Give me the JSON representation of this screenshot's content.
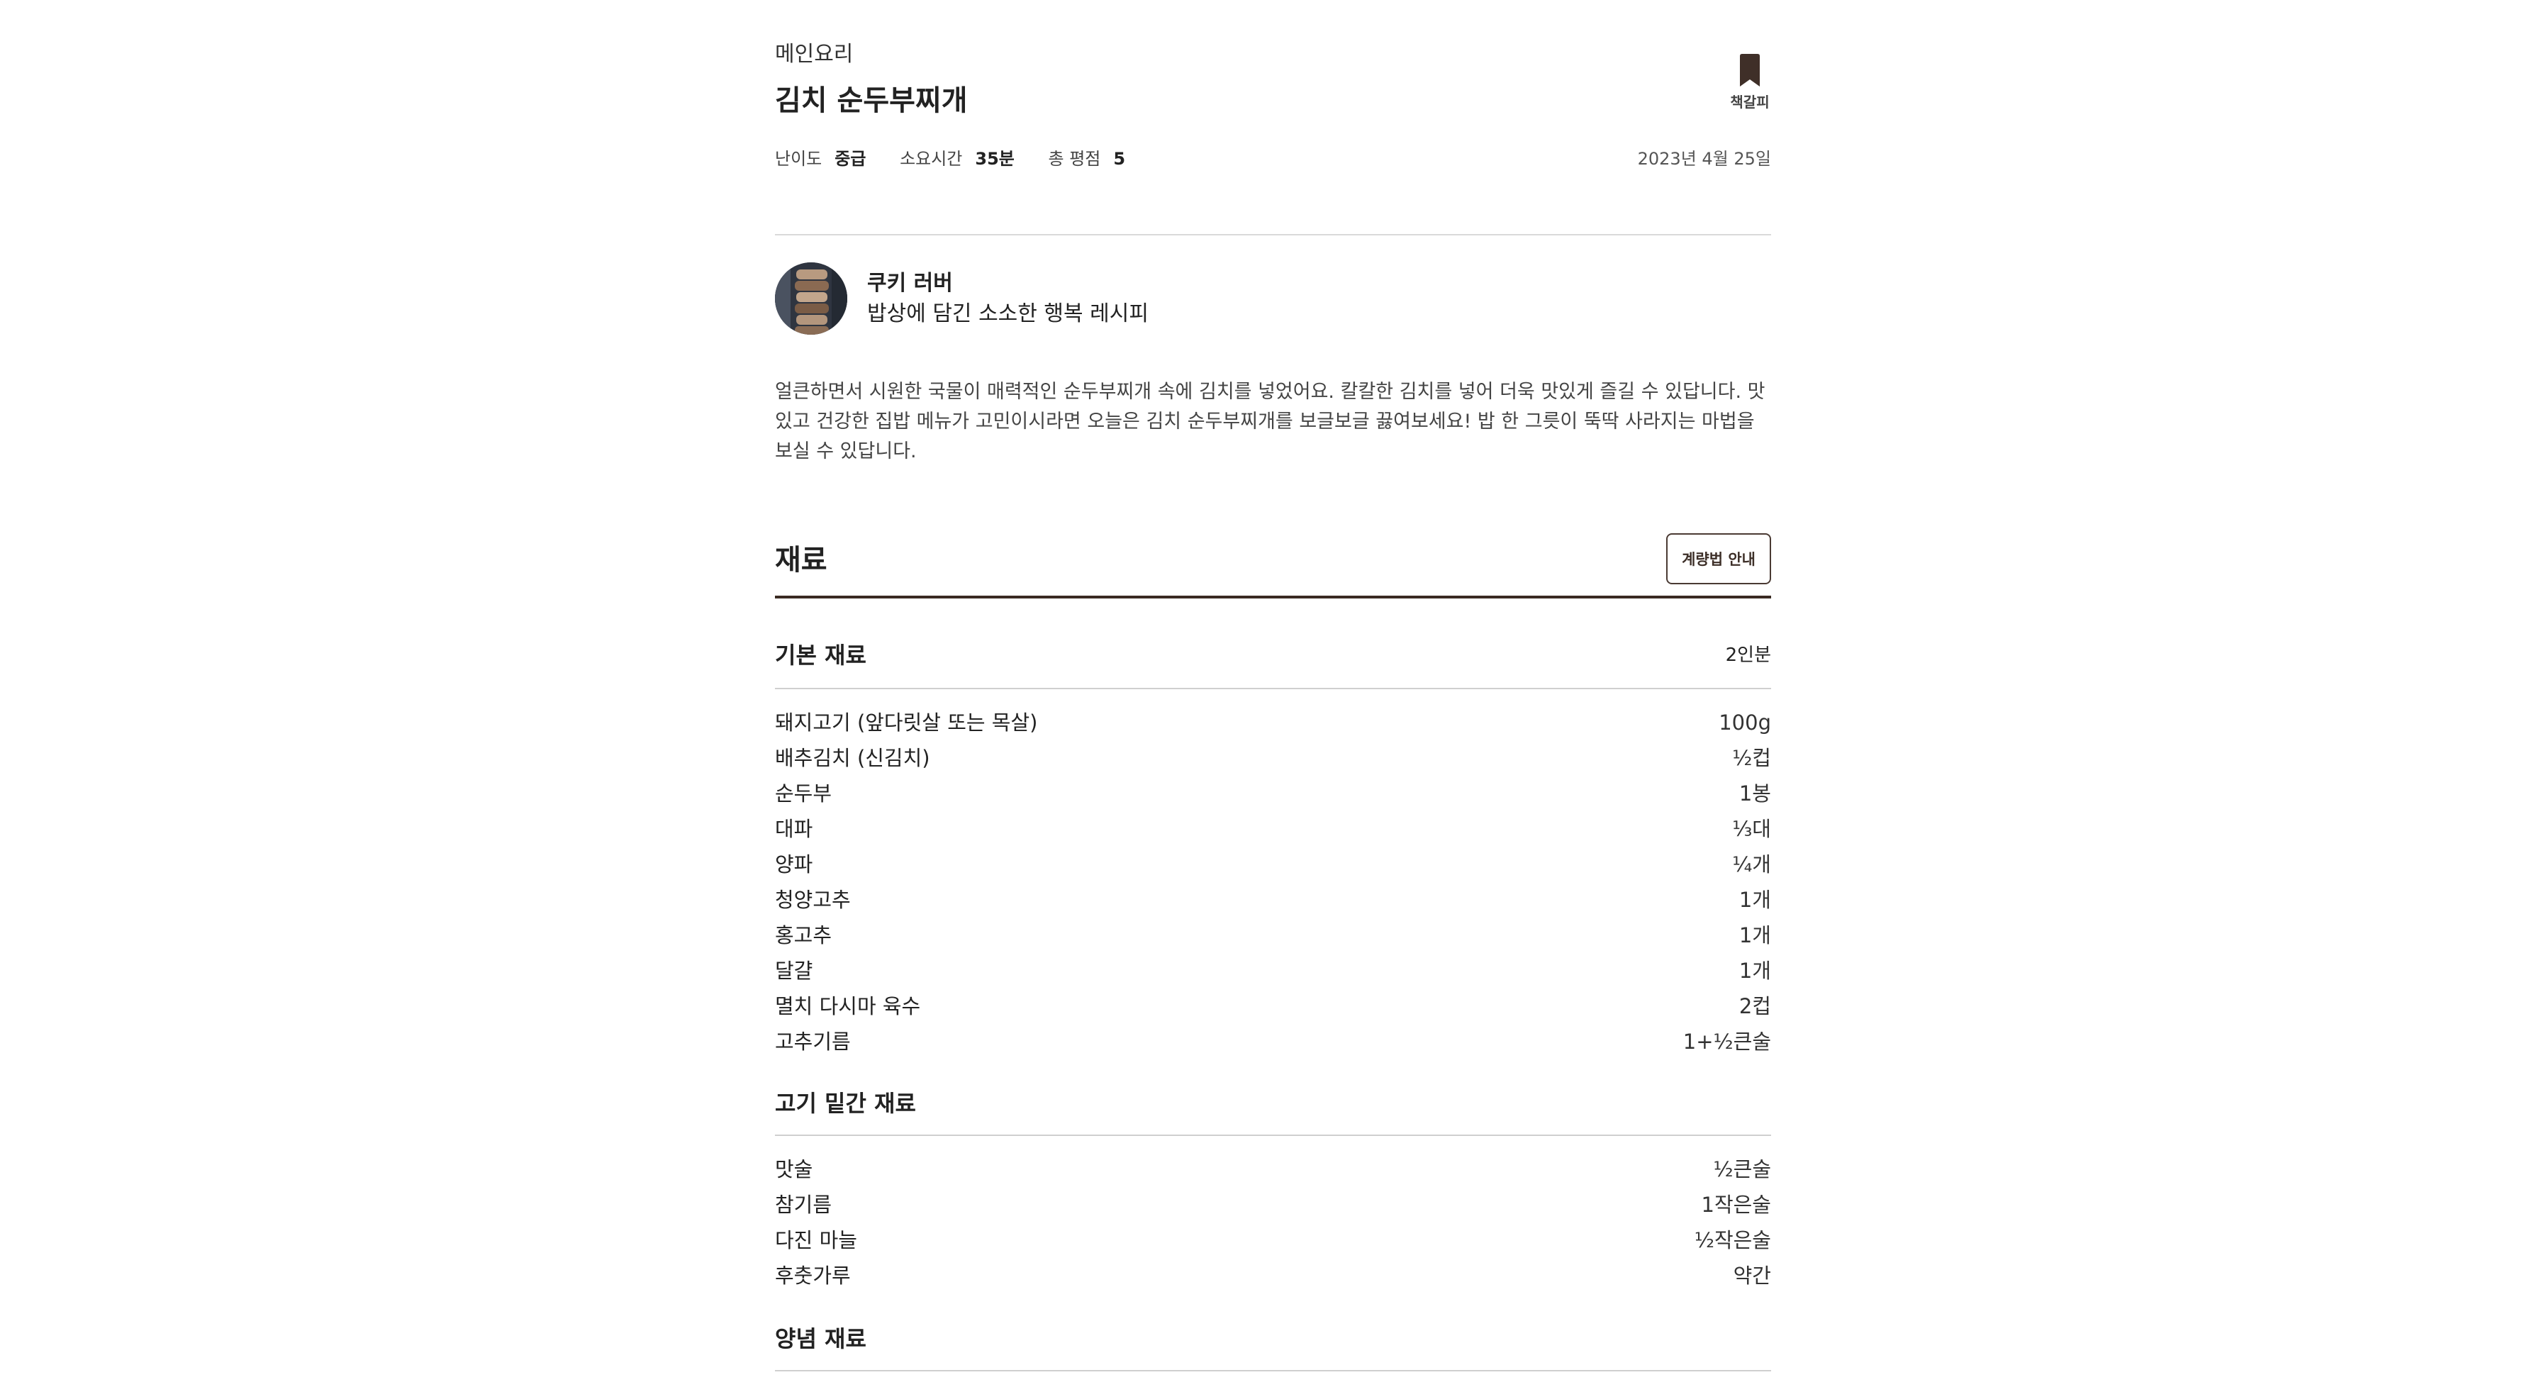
{
  "recipe": {
    "category": "메인요리",
    "title": "김치 순두부찌개",
    "bookmark_label": "책갈피",
    "meta": [
      {
        "label": "난이도",
        "value": "중급"
      },
      {
        "label": "소요시간",
        "value": "35분"
      },
      {
        "label": "총 평점",
        "value": "5"
      }
    ],
    "date": "2023년 4월 25일"
  },
  "author": {
    "name": "쿠키 러버",
    "tagline": "밥상에 담긴 소소한 행복 레시피"
  },
  "description": "얼큰하면서 시원한 국물이 매력적인 순두부찌개 속에 김치를 넣었어요. 칼칼한 김치를 넣어 더욱 맛있게 즐길 수 있답니다. 맛있고 건강한 집밥 메뉴가 고민이시라면 오늘은 김치 순두부찌개를 보글보글 끓여보세요! 밥 한 그릇이 뚝딱 사라지는 마법을 보실 수 있답니다.",
  "ingredients_section": {
    "title": "재료",
    "measure_button": "계량법 안내",
    "groups": [
      {
        "name": "기본 재료",
        "serving": "2인분",
        "items": [
          {
            "name": "돼지고기 (앞다릿살 또는 목살)",
            "qty": "100g"
          },
          {
            "name": "배추김치 (신김치)",
            "qty": "½컵"
          },
          {
            "name": "순두부",
            "qty": "1봉"
          },
          {
            "name": "대파",
            "qty": "⅓대"
          },
          {
            "name": "양파",
            "qty": "¼개"
          },
          {
            "name": "청양고추",
            "qty": "1개"
          },
          {
            "name": "홍고추",
            "qty": "1개"
          },
          {
            "name": "달걀",
            "qty": "1개"
          },
          {
            "name": "멸치 다시마 육수",
            "qty": "2컵"
          },
          {
            "name": "고추기름",
            "qty": "1+½큰술"
          }
        ]
      },
      {
        "name": "고기 밑간 재료",
        "serving": "",
        "items": [
          {
            "name": "맛술",
            "qty": "½큰술"
          },
          {
            "name": "참기름",
            "qty": "1작은술"
          },
          {
            "name": "다진 마늘",
            "qty": "½작은술"
          },
          {
            "name": "후춧가루",
            "qty": "약간"
          }
        ]
      },
      {
        "name": "양념 재료",
        "serving": "",
        "items": []
      }
    ]
  }
}
